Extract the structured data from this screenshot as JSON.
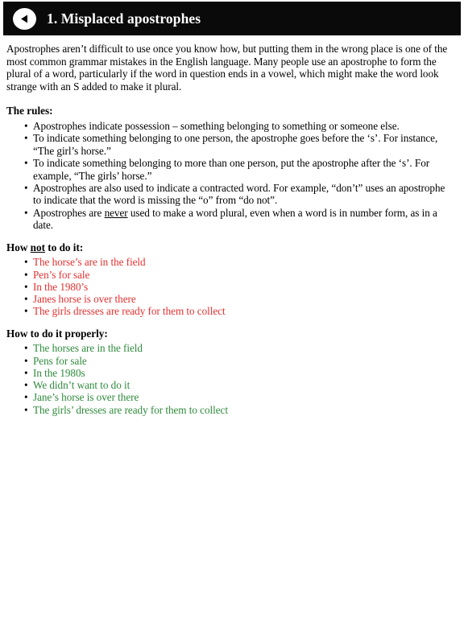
{
  "header": {
    "title": "1. Misplaced apostrophes",
    "back_icon": "back-triangle-icon",
    "background_color": "#0a0a0a",
    "title_color": "#ffffff"
  },
  "content": {
    "intro": "Apostrophes aren’t difficult to use once you know how, but putting them in the wrong place is one of the most common grammar mistakes in the English language. Many people use an apostrophe to form the plural of a word, particularly if the word in question ends in a vowel, which might make the word look strange with an S added to make it plural.",
    "rules_heading": "The rules:",
    "rules": [
      "Apostrophes indicate possession – something belonging to something or someone else.",
      "To indicate something belonging to one person, the apostrophe goes before the ‘s’. For instance, “The girl’s horse.”",
      "To indicate something belonging to more than one person, put the apostrophe after the ‘s’. For example, “The girls’ horse.”",
      "Apostrophes are also used to indicate a contracted word. For example, “don’t” uses an apostrophe to indicate that the word is missing the “o” from “do not”."
    ],
    "rule_last": {
      "before": "Apostrophes are ",
      "underlined": "never",
      "after": " used to make a word plural, even when a word is in number form, as in a date."
    },
    "bad_heading": {
      "before": "How ",
      "underlined": "not",
      "after": " to do it:"
    },
    "bad_color": "#e53030",
    "bad_examples": [
      "The horse’s are in the field",
      "Pen’s for sale",
      "In the 1980’s",
      "Janes horse is over there",
      "The girls dresses are ready for them to collect"
    ],
    "good_heading": "How to do it properly:",
    "good_color": "#2f8b3c",
    "good_examples": [
      "The horses are in the field",
      "Pens for sale",
      "In the 1980s",
      "We didn’t want to do it",
      "Jane’s horse is over there",
      "The girls’ dresses are ready for them to collect"
    ]
  }
}
